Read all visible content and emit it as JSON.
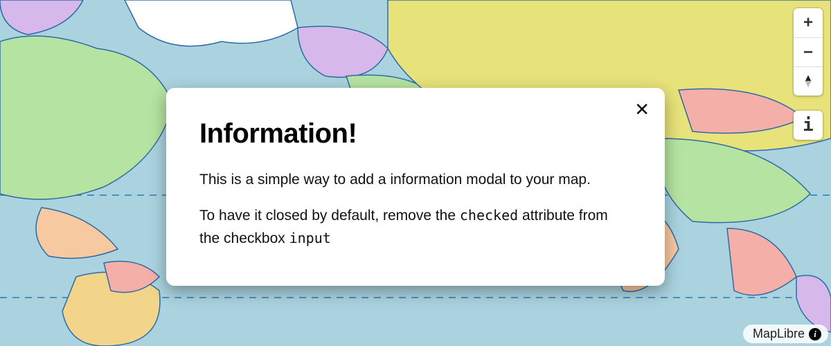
{
  "modal": {
    "title": "Information!",
    "p1": "This is a simple way to add a information modal to your map.",
    "p2_a": "To have it closed by default, remove the ",
    "p2_code1": "checked",
    "p2_b": " attribute from the checkbox ",
    "p2_code2": "input",
    "close_glyph": "✕"
  },
  "controls": {
    "zoom_in": "+",
    "zoom_out": "−",
    "info": "i"
  },
  "attribution": {
    "label": "MapLibre",
    "info_glyph": "i"
  }
}
